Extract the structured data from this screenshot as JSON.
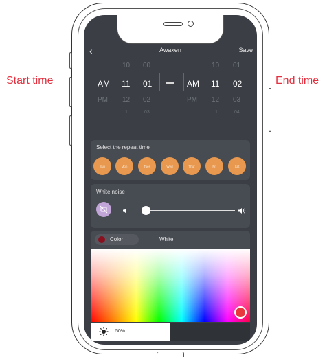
{
  "header": {
    "back_glyph": "‹",
    "title": "Awaken",
    "save_label": "Save"
  },
  "start_picker": {
    "ampm": [
      "",
      "AM",
      "PM",
      ""
    ],
    "hours": [
      "10",
      "11",
      "12",
      "1"
    ],
    "minutes": [
      "00",
      "01",
      "02",
      "03"
    ]
  },
  "end_picker": {
    "ampm": [
      "",
      "AM",
      "PM",
      ""
    ],
    "hours": [
      "10",
      "11",
      "12",
      "1"
    ],
    "minutes": [
      "01",
      "02",
      "03",
      "04"
    ]
  },
  "repeat": {
    "label": "Select the repeat time",
    "days": [
      "Sun",
      "Mon",
      "Tues",
      "Wed",
      "Thur",
      "Fri",
      "Sat"
    ]
  },
  "white_noise": {
    "label": "White noise",
    "volume_fraction": 0.0
  },
  "light": {
    "color_tab": "Color",
    "white_tab": "White",
    "brightness": "50%"
  },
  "callouts": {
    "start": "Start time",
    "end": "End time"
  },
  "colors": {
    "accent": "#e8994f",
    "screen_bg": "#3b3f45",
    "callout": "#e4303e"
  },
  "icons": {
    "back": "chevron-left-icon",
    "noise": "mute-icon",
    "volume_low": "speaker-low-icon",
    "volume_high": "speaker-high-icon",
    "brightness": "sun-icon"
  }
}
